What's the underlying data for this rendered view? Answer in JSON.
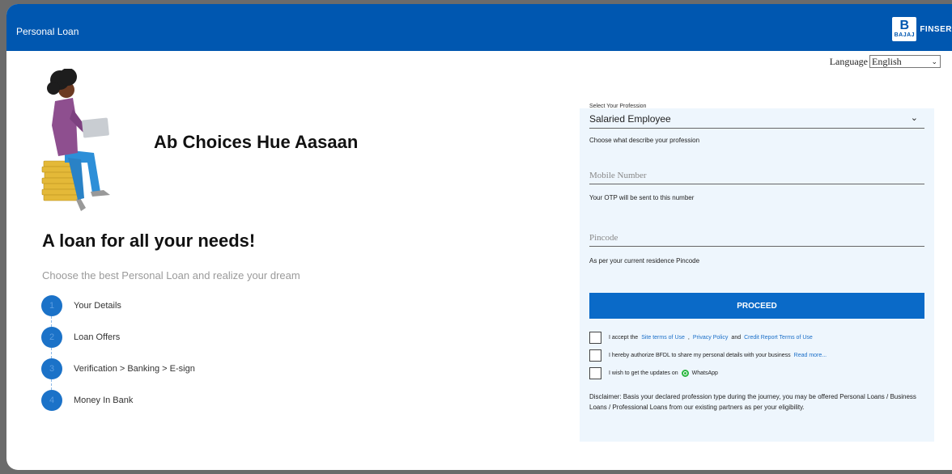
{
  "header": {
    "title": "Personal Loan",
    "brand_logo_letter": "B",
    "brand_logo_text": "BAJAJ",
    "brand_name": "FINSER"
  },
  "language": {
    "label": "Language",
    "selected": "English"
  },
  "hero": {
    "tagline": "Ab Choices Hue Aasaan"
  },
  "main": {
    "heading": "A loan for all your needs!",
    "subheading": "Choose the best Personal Loan and realize your dream",
    "steps": [
      {
        "num": "1",
        "label": "Your Details"
      },
      {
        "num": "2",
        "label": "Loan Offers"
      },
      {
        "num": "3",
        "label": "Verification > Banking > E-sign"
      },
      {
        "num": "4",
        "label": "Money In Bank"
      }
    ]
  },
  "form": {
    "profession_label": "Select Your Profession",
    "profession_value": "Salaried Employee",
    "profession_hint": "Choose what describe your profession",
    "mobile_placeholder": "Mobile Number",
    "mobile_hint": "Your OTP will be sent to this number",
    "pincode_placeholder": "Pincode",
    "pincode_hint": "As per your current residence Pincode",
    "proceed": "PROCEED",
    "consent1_prefix": "I accept the",
    "consent1_link1": "Site terms of Use",
    "consent1_sep": ",",
    "consent1_link2": "Privacy Policy",
    "consent1_and": "and",
    "consent1_link3": "Credit Report Terms of Use",
    "consent2_text": "I hereby authorize BFDL to share my personal details with your business",
    "consent2_link": "Read more...",
    "consent3_text": "I wish to get the updates on",
    "consent3_app": "WhatsApp",
    "disclaimer": "Disclaimer: Basis your declared profession type during the journey, you may be offered Personal Loans / Business Loans / Professional Loans from our existing partners as per your eligibility."
  },
  "colors": {
    "brand_blue": "#0057b0",
    "button_blue": "#0a6ac8",
    "panel_bg": "#eef6fd",
    "step_blue": "#1b72c8",
    "whatsapp_green": "#2bb741"
  }
}
